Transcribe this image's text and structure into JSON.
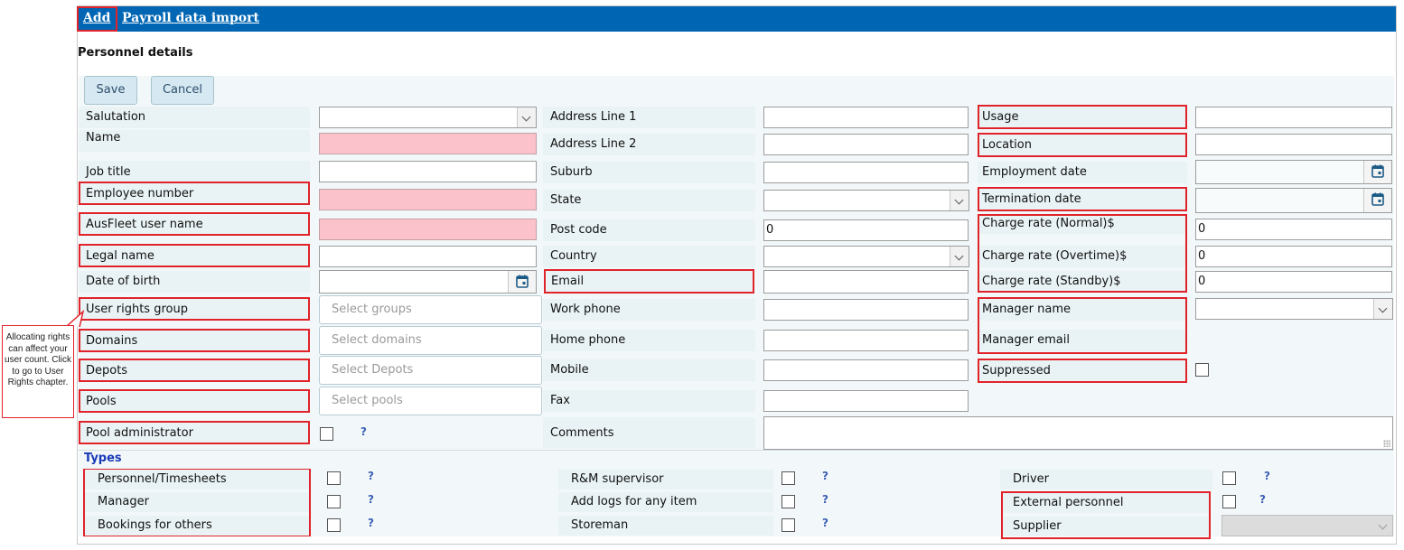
{
  "topbar": {
    "add": "Add",
    "payroll": "Payroll data import"
  },
  "page_title": "Personnel details",
  "buttons": {
    "save": "Save",
    "cancel": "Cancel"
  },
  "col1": {
    "salutation": "Salutation",
    "name": "Name",
    "job_title": "Job title",
    "employee_number": "Employee number",
    "ausfleet_user": "AusFleet user name",
    "legal_name": "Legal name",
    "dob": "Date of birth",
    "user_rights_group": "User rights group",
    "domains": "Domains",
    "depots": "Depots",
    "pools": "Pools",
    "pool_admin": "Pool administrator"
  },
  "placeholders": {
    "groups": "Select groups",
    "domains": "Select domains",
    "depots": "Select Depots",
    "pools": "Select pools"
  },
  "col2": {
    "addr1": "Address Line 1",
    "addr2": "Address Line 2",
    "suburb": "Suburb",
    "state": "State",
    "postcode": "Post code",
    "postcode_value": "0",
    "country": "Country",
    "email": "Email",
    "work_phone": "Work phone",
    "home_phone": "Home phone",
    "mobile": "Mobile",
    "fax": "Fax",
    "comments": "Comments"
  },
  "col3": {
    "usage": "Usage",
    "location": "Location",
    "employment_date": "Employment date",
    "termination_date": "Termination date",
    "charge_normal": "Charge rate (Normal)$",
    "charge_normal_value": "0",
    "charge_overtime": "Charge rate (Overtime)$",
    "charge_overtime_value": "0",
    "charge_standby": "Charge rate (Standby)$",
    "charge_standby_value": "0",
    "manager_name": "Manager name",
    "manager_email": "Manager email",
    "suppressed": "Suppressed"
  },
  "types": {
    "heading": "Types",
    "personnel_timesheets": "Personnel/Timesheets",
    "manager": "Manager",
    "bookings_for_others": "Bookings for others",
    "rm_supervisor": "R&M supervisor",
    "add_logs": "Add logs for any item",
    "storeman": "Storeman",
    "driver": "Driver",
    "external_personnel": "External personnel",
    "supplier": "Supplier",
    "help_glyph": "?"
  },
  "callout": {
    "text": "Allocating rights can affect your user count. Click to go to User Rights chapter."
  },
  "colors": {
    "topbar": "#0066b3",
    "highlight": "#e0232a",
    "required": "#fbc2cb",
    "types_heading": "#1a3ab8"
  }
}
